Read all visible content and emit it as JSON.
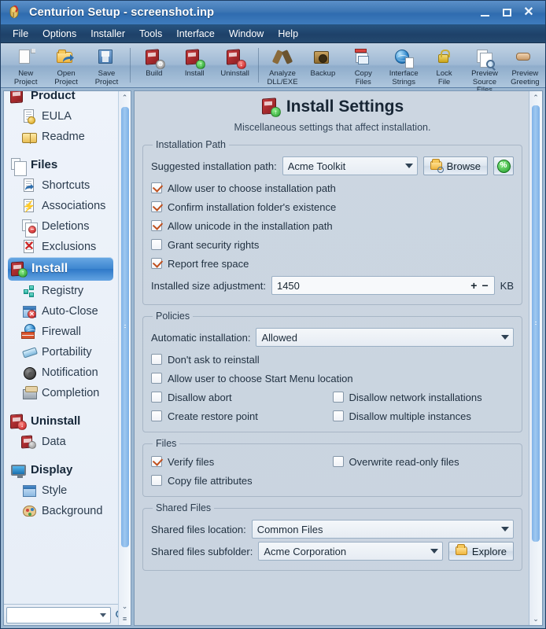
{
  "window": {
    "title": "Centurion Setup - screenshot.inp",
    "app_icon": "spartan-helmet-icon",
    "minimize": "_",
    "maximize": "□",
    "close": "✕"
  },
  "menubar": {
    "items": [
      {
        "label": "File"
      },
      {
        "label": "Options"
      },
      {
        "label": "Installer"
      },
      {
        "label": "Tools"
      },
      {
        "label": "Interface"
      },
      {
        "label": "Window"
      },
      {
        "label": "Help"
      }
    ]
  },
  "toolbar": {
    "buttons": [
      {
        "label": "New\nProject",
        "icon": "new-document-icon"
      },
      {
        "label": "Open\nProject",
        "icon": "open-folder-icon"
      },
      {
        "label": "Save\nProject",
        "icon": "floppy-disk-icon"
      },
      {
        "label": "Build",
        "icon": "build-box-icon"
      },
      {
        "label": "Install",
        "icon": "install-box-icon"
      },
      {
        "label": "Uninstall",
        "icon": "uninstall-box-icon"
      },
      {
        "label": "Analyze\nDLL/EXE",
        "icon": "wrench-icon"
      },
      {
        "label": "Backup",
        "icon": "safe-icon"
      },
      {
        "label": "Copy\nFiles",
        "icon": "copy-files-icon"
      },
      {
        "label": "Interface\nStrings",
        "icon": "globe-icon"
      },
      {
        "label": "Lock\nFile",
        "icon": "padlock-icon"
      },
      {
        "label": "Preview\nSource Files",
        "icon": "preview-source-icon"
      },
      {
        "label": "Preview\nGreeting",
        "icon": "handshake-icon"
      }
    ]
  },
  "sidebar": {
    "items": [
      {
        "label": "Product",
        "level": "group",
        "icon": "product-box-icon",
        "selected": false
      },
      {
        "label": "EULA",
        "level": "child",
        "icon": "eula-document-icon",
        "selected": false
      },
      {
        "label": "Readme",
        "level": "child",
        "icon": "readme-book-icon",
        "selected": false
      },
      {
        "label": "Files",
        "level": "group",
        "icon": "files-stack-icon",
        "selected": false
      },
      {
        "label": "Shortcuts",
        "level": "child",
        "icon": "shortcut-icon",
        "selected": false
      },
      {
        "label": "Associations",
        "level": "child",
        "icon": "association-icon",
        "selected": false
      },
      {
        "label": "Deletions",
        "level": "child",
        "icon": "deletions-icon",
        "selected": false
      },
      {
        "label": "Exclusions",
        "level": "child",
        "icon": "exclusions-icon",
        "selected": false
      },
      {
        "label": "Install",
        "level": "group",
        "icon": "install-box-icon",
        "selected": true
      },
      {
        "label": "Registry",
        "level": "child",
        "icon": "registry-icon",
        "selected": false
      },
      {
        "label": "Auto-Close",
        "level": "child",
        "icon": "auto-close-icon",
        "selected": false
      },
      {
        "label": "Firewall",
        "level": "child",
        "icon": "firewall-icon",
        "selected": false
      },
      {
        "label": "Portability",
        "level": "child",
        "icon": "usb-icon",
        "selected": false
      },
      {
        "label": "Notification",
        "level": "child",
        "icon": "speaker-icon",
        "selected": false
      },
      {
        "label": "Completion",
        "level": "child",
        "icon": "completion-icon",
        "selected": false
      },
      {
        "label": "Uninstall",
        "level": "group",
        "icon": "uninstall-box-icon",
        "selected": false
      },
      {
        "label": "Data",
        "level": "child",
        "icon": "data-box-icon",
        "selected": false
      },
      {
        "label": "Display",
        "level": "group",
        "icon": "monitor-icon",
        "selected": false
      },
      {
        "label": "Style",
        "level": "child",
        "icon": "style-window-icon",
        "selected": false
      },
      {
        "label": "Background",
        "level": "child",
        "icon": "palette-icon",
        "selected": false
      }
    ],
    "search": {
      "value": "",
      "placeholder": "",
      "dropdown_icon": "chevron-down-icon",
      "go_icon": "magnifier-icon"
    },
    "scroll_up_icon": "chevron-up-icon",
    "scroll_down_icon": "chevron-down-icon"
  },
  "page": {
    "icon": "install-box-icon",
    "title": "Install Settings",
    "subtitle": "Miscellaneous settings that affect installation."
  },
  "groups": {
    "installation_path": {
      "legend": "Installation Path",
      "path_label": "Suggested installation path:",
      "path_value": "Acme Toolkit",
      "browse_label": "Browse",
      "browse_icon": "folder-search-icon",
      "percent_label": "%",
      "percent_icon": "percent-badge-icon",
      "checkboxes": [
        {
          "label": "Allow user to choose installation path",
          "checked": true
        },
        {
          "label": "Confirm installation folder's existence",
          "checked": true
        },
        {
          "label": "Allow unicode in the installation path",
          "checked": true
        },
        {
          "label": "Grant security rights",
          "checked": false
        },
        {
          "label": "Report free space",
          "checked": true
        }
      ],
      "size_label": "Installed size adjustment:",
      "size_value": "1450",
      "size_plus": "+",
      "size_minus": "−",
      "size_unit": "KB"
    },
    "policies": {
      "legend": "Policies",
      "auto_label": "Automatic installation:",
      "auto_value": "Allowed",
      "checkboxes_left": [
        {
          "label": "Don't ask to reinstall",
          "checked": false
        },
        {
          "label": "Allow user to choose Start Menu location",
          "checked": false
        },
        {
          "label": "Disallow abort",
          "checked": false
        },
        {
          "label": "Create restore point",
          "checked": false
        }
      ],
      "checkboxes_right": [
        {
          "label": "Disallow network installations",
          "checked": false
        },
        {
          "label": "Disallow multiple instances",
          "checked": false
        }
      ]
    },
    "files": {
      "legend": "Files",
      "checkboxes_left": [
        {
          "label": "Verify files",
          "checked": true
        },
        {
          "label": "Copy file attributes",
          "checked": false
        }
      ],
      "checkboxes_right": [
        {
          "label": "Overwrite read-only files",
          "checked": false
        }
      ]
    },
    "shared_files": {
      "legend": "Shared Files",
      "location_label": "Shared files location:",
      "location_value": "Common Files",
      "subfolder_label": "Shared files subfolder:",
      "subfolder_value": "Acme Corporation",
      "explore_label": "Explore",
      "explore_icon": "folder-icon"
    }
  },
  "colors": {
    "title_bar": "#3d76b4",
    "menu_bar": "#1e4169",
    "selection": "#3d86d0",
    "checkmark": "#c0501e",
    "panel_bg": "#ccd6e1",
    "scrollbar_thumb": "#8dbbec"
  }
}
